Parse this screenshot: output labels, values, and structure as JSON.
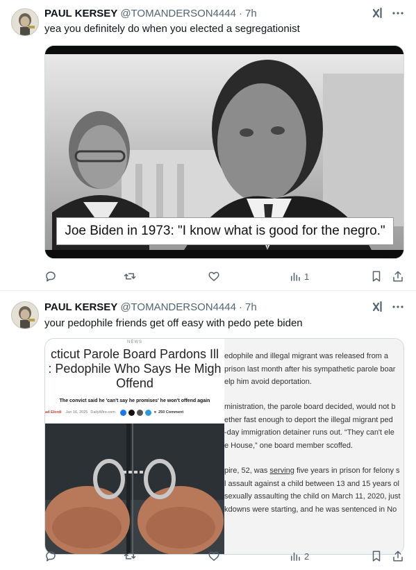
{
  "tweets": [
    {
      "author_name": "PAUL KERSEY",
      "handle": "@TOMANDERSON4444",
      "separator": "·",
      "time": "7h",
      "text": "yea you definitely do when you elected a segregationist",
      "image_caption": "Joe Biden in 1973: \"I know what is good for the negro.\"",
      "actions": {
        "replies": "",
        "retweets": "",
        "likes": "",
        "views": "1"
      }
    },
    {
      "author_name": "PAUL KERSEY",
      "handle": "@TOMANDERSON4444",
      "separator": "·",
      "time": "7h",
      "text": "your pedophile friends get off easy with pedo pete biden",
      "article": {
        "tag": "NEWS",
        "headline_lines": [
          "cticut Parole Board Pardons Ill",
          ": Pedophile Who Says He Migh",
          "Offend"
        ],
        "subheadline": "The convict said he 'can't say he promises' he won't offend again",
        "author": "ad Elordi",
        "date": "Jan 16, 2025",
        "source": "DailyWire.com",
        "comments": "250 Comment",
        "body_lines": [
          "edophile and illegal migrant was released from a",
          "prison last month after his sympathetic parole boar",
          "elp him avoid deportation.",
          "",
          "ministration, the parole board decided, would not b",
          "ether fast enough to deport the illegal migrant ped",
          "-day immigration detainer runs out. “They can't ele",
          "e House,” one board member scoffed.",
          "",
          "pire, 52, was serving five years in prison for felony s",
          "l assault against a child between 13 and 15 years ol",
          "sexually assaulting the child on March 11, 2020, just",
          "kdowns were starting, and he was sentenced in No"
        ],
        "underlined_word": "serving"
      },
      "actions": {
        "replies": "",
        "retweets": "",
        "likes": "",
        "views": "2"
      }
    }
  ],
  "icons": {
    "reply": "reply-icon",
    "retweet": "retweet-icon",
    "like": "like-icon",
    "views": "views-icon",
    "bookmark": "bookmark-icon",
    "share": "share-icon",
    "grok": "grok-icon",
    "more": "more-icon"
  },
  "colors": {
    "text_primary": "#0f1419",
    "text_secondary": "#536471",
    "border": "#cfd9de",
    "divider": "#eff3f4"
  }
}
